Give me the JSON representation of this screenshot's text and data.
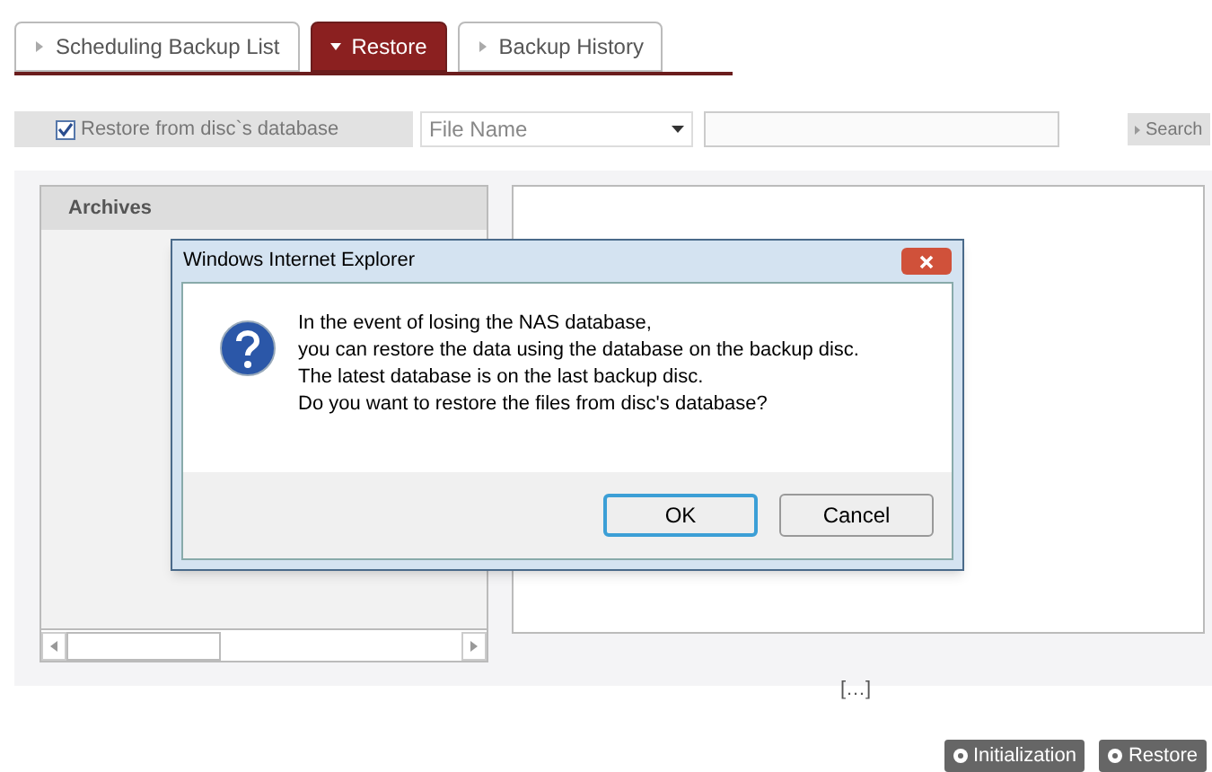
{
  "tabs": [
    {
      "label": "Scheduling Backup List",
      "selected": false
    },
    {
      "label": "Restore",
      "selected": true
    },
    {
      "label": "Backup History",
      "selected": false
    }
  ],
  "toolbar": {
    "checkbox": {
      "label": "Restore from disc`s database",
      "checked": true
    },
    "filter_select": {
      "value": "File Name"
    },
    "search_button": "Search"
  },
  "archives_panel": {
    "title": "Archives"
  },
  "pager": "[…]",
  "actions": [
    "Initialization",
    "Restore"
  ],
  "dialog": {
    "title": "Windows Internet Explorer",
    "message_lines": [
      "In the event of losing the NAS database,",
      "you can restore the data using the database on the backup disc.",
      "The latest database is on the last backup disc.",
      "Do you want to restore the files from disc's database?"
    ],
    "buttons": [
      {
        "label": "OK",
        "selected": true
      },
      {
        "label": "Cancel",
        "selected": false
      }
    ]
  }
}
